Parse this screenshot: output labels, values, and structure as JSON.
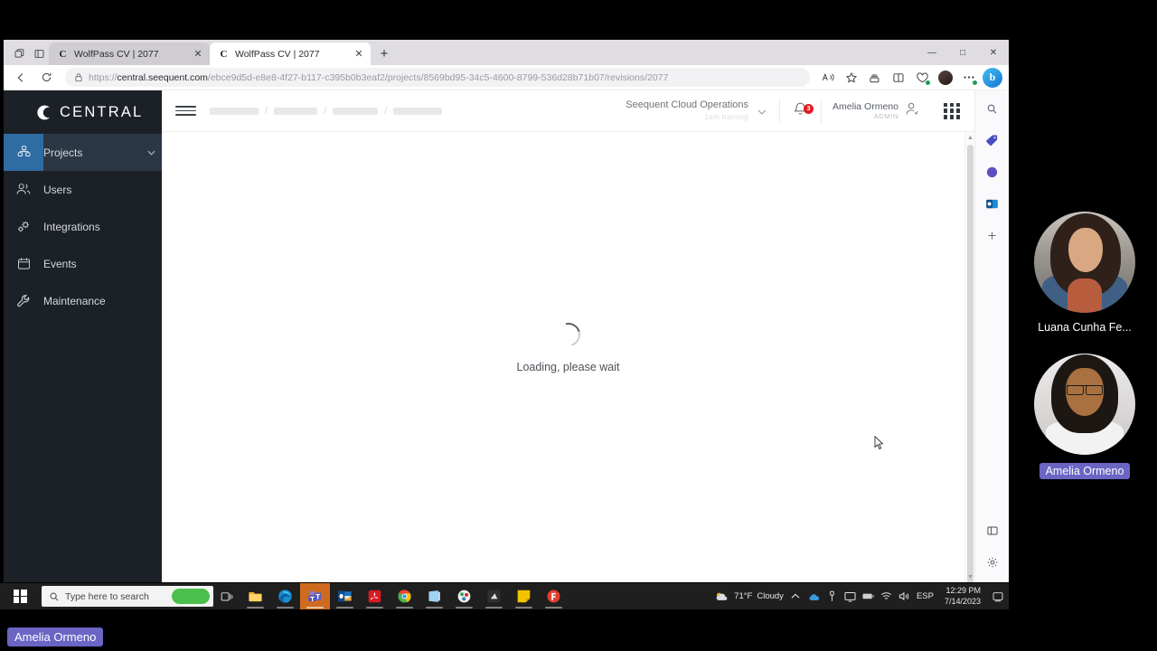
{
  "browser": {
    "tabs": [
      {
        "favicon": "C",
        "title": "WolfPass CV | 2077",
        "active": false
      },
      {
        "favicon": "C",
        "title": "WolfPass CV | 2077",
        "active": true
      }
    ],
    "new_tab_label": "+",
    "window_controls": {
      "minimize": "—",
      "maximize": "□",
      "close": "✕"
    },
    "url": {
      "scheme": "https://",
      "host": "central.seequent.com",
      "path": "/ebce9d5d-e8e8-4f27-b117-c395b0b3eaf2/projects/8569bd95-34c5-4600-8799-536d28b71b07/revisions/2077",
      "full": "https://central.seequent.com/ebce9d5d-e8e8-4f27-b117-c395b0b3eaf2/projects/8569bd95-34c5-4600-8799-536d28b71b07/revisions/2077"
    },
    "toolbar_icons": [
      "read-aloud-icon",
      "favorite-star-icon",
      "collections-icon",
      "split-screen-icon",
      "browser-essentials-icon",
      "profile-avatar",
      "more-options-icon",
      "bing-copilot-icon"
    ],
    "bing_label": "b"
  },
  "edge_sidebar": {
    "items": [
      {
        "name": "search-icon",
        "glyph": "⌕"
      },
      {
        "name": "shopping-tag-icon",
        "glyph": "◆"
      },
      {
        "name": "copilot-icon",
        "glyph": "●"
      },
      {
        "name": "outlook-icon",
        "glyph": "✉"
      },
      {
        "name": "add-sidebar-app-icon",
        "glyph": "+"
      }
    ],
    "bottom_items": [
      {
        "name": "split-pane-icon",
        "glyph": "◫"
      },
      {
        "name": "sidebar-settings-icon",
        "glyph": "⚙"
      }
    ]
  },
  "app": {
    "brand": "CENTRAL",
    "sidebar": {
      "items": [
        {
          "label": "Projects",
          "icon": "projects-icon",
          "active": true,
          "has_caret": true
        },
        {
          "label": "Users",
          "icon": "users-icon",
          "active": false,
          "has_caret": false
        },
        {
          "label": "Integrations",
          "icon": "integrations-icon",
          "active": false,
          "has_caret": false
        },
        {
          "label": "Events",
          "icon": "events-icon",
          "active": false,
          "has_caret": false
        },
        {
          "label": "Maintenance",
          "icon": "maintenance-icon",
          "active": false,
          "has_caret": false
        }
      ]
    },
    "appbar": {
      "menu_icon": "hamburger-menu-icon",
      "breadcrumb_skeleton_widths": [
        54,
        48,
        50,
        54
      ],
      "breadcrumb_separator": "/",
      "org_name": "Seequent Cloud Operations",
      "org_sub": "1am training",
      "org_caret": "⌄",
      "notifications_count": "3",
      "user_name": "Amelia Ormeno",
      "user_role": "ADMIN",
      "app_launcher": "app-launcher-grid"
    },
    "content": {
      "loading_text": "Loading, please wait"
    }
  },
  "meeting": {
    "participants": [
      {
        "name": "Luana Cunha Fe...",
        "speaking": false
      },
      {
        "name": "Amelia Ormeno",
        "speaking": true
      }
    ],
    "caption_name": "Amelia Ormeno",
    "speaking_highlight_color": "#6b65c4"
  },
  "taskbar": {
    "start_label": "windows-start",
    "search_placeholder": "Type here to search",
    "task_view": "task-view-icon",
    "apps": [
      {
        "name": "file-explorer",
        "color": "#e8b84b",
        "running": true,
        "active": false
      },
      {
        "name": "microsoft-edge",
        "color": "#1e8fd1",
        "running": true,
        "active": false
      },
      {
        "name": "microsoft-teams",
        "color": "#5b5fc7",
        "running": true,
        "active": true
      },
      {
        "name": "microsoft-outlook",
        "color": "#0f6cbd",
        "running": true,
        "active": false
      },
      {
        "name": "adobe-acrobat",
        "color": "#d61b21",
        "running": true,
        "active": false
      },
      {
        "name": "google-chrome",
        "color": "#49a84c",
        "running": true,
        "active": false
      },
      {
        "name": "onenote",
        "color": "#8ebfe0",
        "running": true,
        "active": false
      },
      {
        "name": "app-circle",
        "color": "#e0e0e0",
        "running": true,
        "active": false
      },
      {
        "name": "app-dark",
        "color": "#3b3b3b",
        "running": true,
        "active": false
      },
      {
        "name": "sticky-notes",
        "color": "#f2c300",
        "running": true,
        "active": false
      },
      {
        "name": "app-red-circle",
        "color": "#e4402f",
        "running": true,
        "active": false
      }
    ],
    "tray": {
      "weather_temp": "71°F",
      "weather_desc": "Cloudy",
      "chevron": "∧",
      "icons": [
        "onedrive-icon",
        "usb-icon",
        "display-icon",
        "battery-icon",
        "wifi-icon",
        "volume-icon"
      ],
      "language": "ESP",
      "time": "12:29 PM",
      "date": "7/14/2023",
      "action_center": "notifications-icon"
    }
  }
}
